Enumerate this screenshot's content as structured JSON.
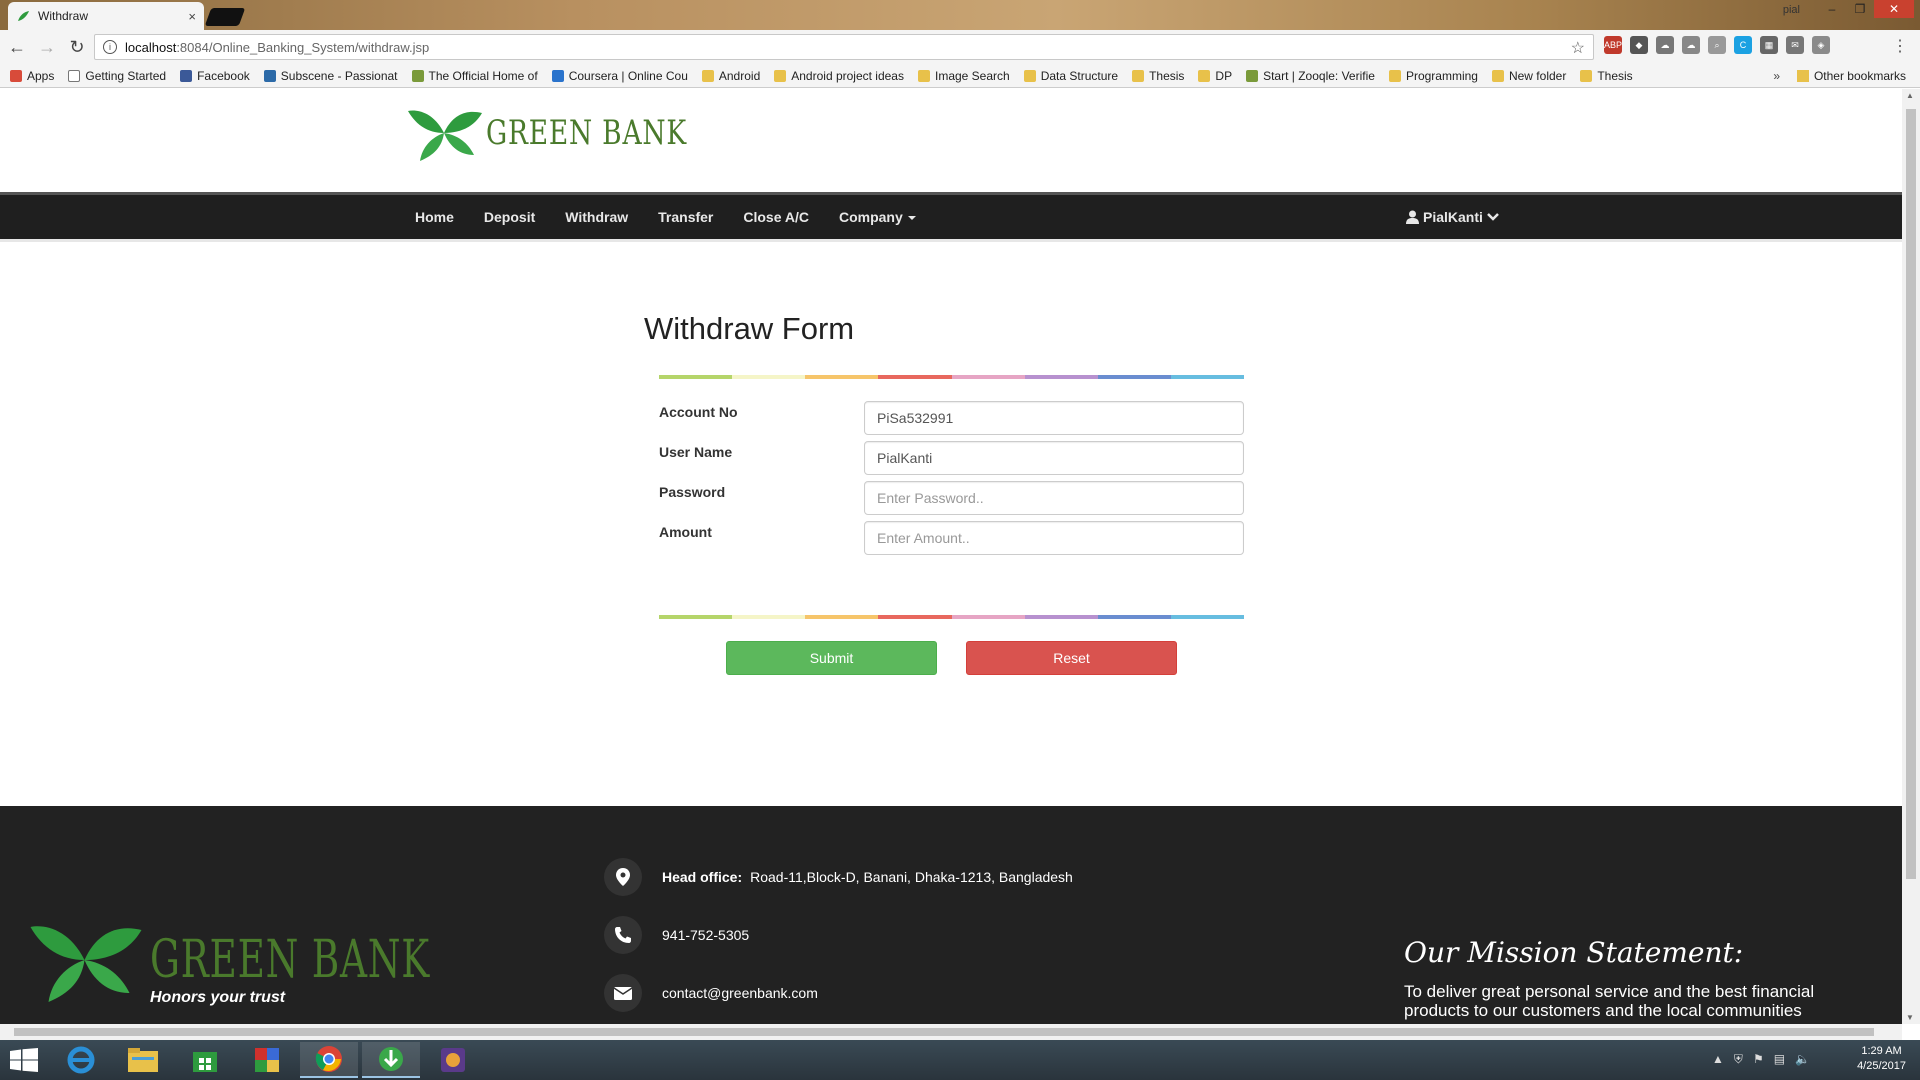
{
  "browser": {
    "tab_title": "Withdraw",
    "tab_close": "×",
    "window_user": "pial",
    "url_host": "localhost",
    "url_path": ":8084/Online_Banking_System/withdraw.jsp",
    "bookmarks": [
      {
        "label": "Apps",
        "icon": "apps-grid-icon"
      },
      {
        "label": "Getting Started",
        "icon": "page-icon"
      },
      {
        "label": "Facebook",
        "icon": "facebook-icon"
      },
      {
        "label": "Subscene - Passionat",
        "icon": "subscene-icon"
      },
      {
        "label": "The Official Home of",
        "icon": "site-icon"
      },
      {
        "label": "Coursera | Online Cou",
        "icon": "coursera-icon"
      },
      {
        "label": "Android",
        "icon": "folder-icon"
      },
      {
        "label": "Android project ideas",
        "icon": "folder-icon"
      },
      {
        "label": "Image Search",
        "icon": "folder-icon"
      },
      {
        "label": "Data Structure",
        "icon": "folder-icon"
      },
      {
        "label": "Thesis",
        "icon": "folder-icon"
      },
      {
        "label": "DP",
        "icon": "folder-icon"
      },
      {
        "label": "Start | Zooqle: Verifie",
        "icon": "site-icon"
      },
      {
        "label": "Programming",
        "icon": "folder-icon"
      },
      {
        "label": "New folder",
        "icon": "folder-icon"
      },
      {
        "label": "Thesis",
        "icon": "folder-icon"
      }
    ],
    "bookmarks_more": "»",
    "other_bookmarks": "Other bookmarks"
  },
  "site": {
    "brand": "GREEN BANK",
    "nav": [
      "Home",
      "Deposit",
      "Withdraw",
      "Transfer",
      "Close A/C",
      "Company"
    ],
    "user": "PialKanti"
  },
  "form": {
    "title": "Withdraw Form",
    "fields": [
      {
        "label": "Account No",
        "value": "PiSa532991",
        "placeholder": ""
      },
      {
        "label": "User Name",
        "value": "PialKanti",
        "placeholder": ""
      },
      {
        "label": "Password",
        "value": "",
        "placeholder": "Enter Password.."
      },
      {
        "label": "Amount",
        "value": "",
        "placeholder": "Enter Amount.."
      }
    ],
    "submit": "Submit",
    "reset": "Reset",
    "rainbow_colors": [
      "#b5d56a",
      "#f5f5c8",
      "#f6c56a",
      "#e8685e",
      "#e6a5c4",
      "#b791cf",
      "#6a8dd0",
      "#67bde0"
    ]
  },
  "footer": {
    "brand": "GREEN BANK",
    "tagline": "Honors your trust",
    "head_office_label": "Head office:",
    "head_office": "Road-11,Block-D, Banani, Dhaka-1213, Bangladesh",
    "phone": "941-752-5305",
    "email": "contact@greenbank.com",
    "mission_title": "Our Mission Statement:",
    "mission_text": "To deliver great personal service and the best financial products to our customers and the local communities we serve."
  },
  "taskbar": {
    "time": "1:29 AM",
    "date": "4/25/2017"
  },
  "colors": {
    "brand_green": "#4a7a2c",
    "leaf_green": "#2e9b3e",
    "navbar": "#1f1f1f",
    "footer": "#222222",
    "submit": "#5cb85c",
    "reset": "#d9534f"
  }
}
